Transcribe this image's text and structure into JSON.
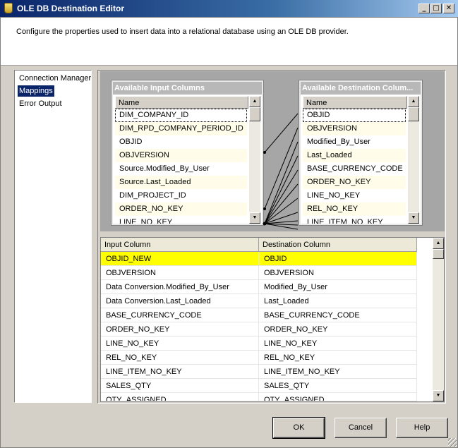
{
  "window": {
    "title": "OLE DB Destination Editor",
    "min_glyph": "_",
    "max_glyph": "□",
    "close_glyph": "✕"
  },
  "header": {
    "description": "Configure the properties used to insert data into a relational database using an OLE DB provider."
  },
  "sidebar": {
    "items": [
      {
        "label": "Connection Manager",
        "selected": false
      },
      {
        "label": "Mappings",
        "selected": true
      },
      {
        "label": "Error Output",
        "selected": false
      }
    ]
  },
  "available_input": {
    "title": "Available Input Columns",
    "header": "Name",
    "rows": [
      "DIM_COMPANY_ID",
      "DIM_RPD_COMPANY_PERIOD_ID",
      "OBJID",
      "OBJVERSION",
      "Source.Modified_By_User",
      "Source.Last_Loaded",
      "DIM_PROJECT_ID",
      "ORDER_NO_KEY",
      "LINE_NO_KEY"
    ]
  },
  "available_destination": {
    "title": "Available Destination Colum...",
    "header": "Name",
    "rows": [
      "OBJID",
      "OBJVERSION",
      "Modified_By_User",
      "Last_Loaded",
      "BASE_CURRENCY_CODE",
      "ORDER_NO_KEY",
      "LINE_NO_KEY",
      "REL_NO_KEY",
      "LINE_ITEM_NO_KEY"
    ]
  },
  "mappings_grid": {
    "columns": [
      "Input Column",
      "Destination Column"
    ],
    "rows": [
      {
        "input": "OBJID_NEW",
        "destination": "OBJID",
        "highlighted": true
      },
      {
        "input": "OBJVERSION",
        "destination": "OBJVERSION",
        "highlighted": false
      },
      {
        "input": "Data Conversion.Modified_By_User",
        "destination": "Modified_By_User",
        "highlighted": false
      },
      {
        "input": "Data Conversion.Last_Loaded",
        "destination": "Last_Loaded",
        "highlighted": false
      },
      {
        "input": "BASE_CURRENCY_CODE",
        "destination": "BASE_CURRENCY_CODE",
        "highlighted": false
      },
      {
        "input": "ORDER_NO_KEY",
        "destination": "ORDER_NO_KEY",
        "highlighted": false
      },
      {
        "input": "LINE_NO_KEY",
        "destination": "LINE_NO_KEY",
        "highlighted": false
      },
      {
        "input": "REL_NO_KEY",
        "destination": "REL_NO_KEY",
        "highlighted": false
      },
      {
        "input": "LINE_ITEM_NO_KEY",
        "destination": "LINE_ITEM_NO_KEY",
        "highlighted": false
      },
      {
        "input": "SALES_QTY",
        "destination": "SALES_QTY",
        "highlighted": false
      },
      {
        "input": "QTY_ASSIGNED",
        "destination": "QTY_ASSIGNED",
        "highlighted": false
      }
    ]
  },
  "buttons": {
    "ok": "OK",
    "cancel": "Cancel",
    "help": "Help"
  },
  "colors": {
    "highlight_row": "#ffff00",
    "selected_item": "#0a246a",
    "alt_row": "#fffde9"
  }
}
